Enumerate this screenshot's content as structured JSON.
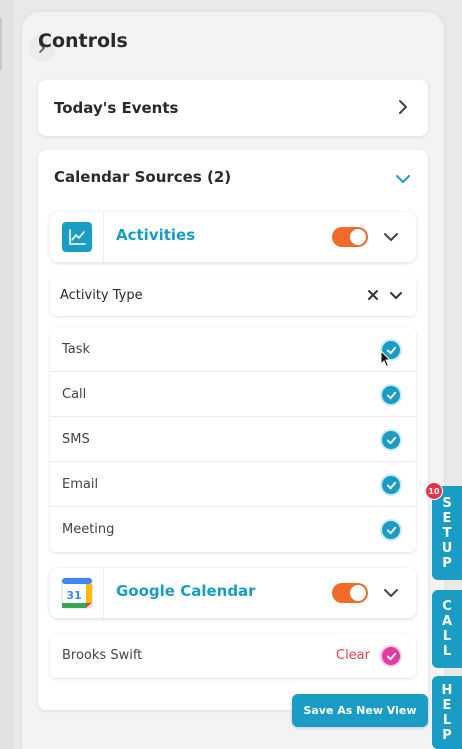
{
  "panel": {
    "title": "Controls"
  },
  "events": {
    "label": "Today's Events"
  },
  "sources": {
    "heading": "Calendar Sources (2)",
    "activities": {
      "name": "Activities",
      "enabled": true,
      "icon": "chart-line-icon",
      "activity_type_label": "Activity Type",
      "options": [
        {
          "label": "Task",
          "checked": true
        },
        {
          "label": "Call",
          "checked": true
        },
        {
          "label": "SMS",
          "checked": true
        },
        {
          "label": "Email",
          "checked": true
        },
        {
          "label": "Meeting",
          "checked": true
        }
      ]
    },
    "google": {
      "name": "Google Calendar",
      "enabled": true,
      "icon": "google-calendar-icon",
      "icon_text": "31",
      "person": {
        "name": "Brooks Swift",
        "clear_label": "Clear",
        "checked": true
      }
    }
  },
  "actions": {
    "save_label": "Save As New View"
  },
  "side_tabs": {
    "setup": {
      "label": "SETUP",
      "letters": [
        "S",
        "E",
        "T",
        "U",
        "P"
      ],
      "badge": "10"
    },
    "call": {
      "label": "CALL",
      "letters": [
        "C",
        "A",
        "L",
        "L"
      ]
    },
    "help": {
      "label": "HELP",
      "letters": [
        "H",
        "E",
        "L",
        "P"
      ]
    }
  },
  "colors": {
    "accent": "#1a9cc4",
    "toggle_on": "#f06a2a",
    "clear": "#e0454f",
    "person_check": "#e23aa3",
    "badge": "#e3344a"
  }
}
